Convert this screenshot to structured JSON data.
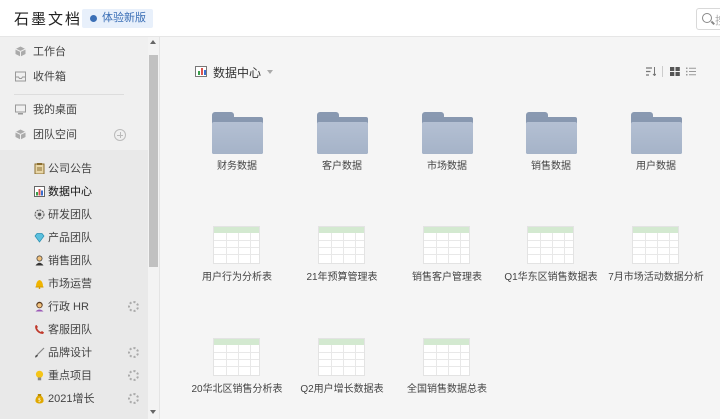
{
  "header": {
    "brand": "石墨文档",
    "beta_label": "体验新版",
    "search_placeholder": "搜"
  },
  "sidebar": {
    "top_items": [
      {
        "label": "工作台",
        "icon": "cube-icon"
      },
      {
        "label": "收件箱",
        "icon": "inbox-icon"
      }
    ],
    "desktop": {
      "label": "我的桌面",
      "icon": "desktop-icon"
    },
    "team_space": {
      "label": "团队空间",
      "icon": "cube-icon"
    },
    "teams": [
      {
        "label": "公司公告",
        "icon": "clipboard-icon"
      },
      {
        "label": "数据中心",
        "icon": "bar-chart-icon",
        "active": true
      },
      {
        "label": "研发团队",
        "icon": "gear-emoji-icon"
      },
      {
        "label": "产品团队",
        "icon": "diamond-icon"
      },
      {
        "label": "销售团队",
        "icon": "person-icon"
      },
      {
        "label": "市场运营",
        "icon": "bell-icon"
      },
      {
        "label": "行政 HR",
        "icon": "woman-icon",
        "settings": true
      },
      {
        "label": "客服团队",
        "icon": "phone-icon"
      },
      {
        "label": "品牌设计",
        "icon": "brush-icon",
        "settings": true
      },
      {
        "label": "重点项目",
        "icon": "lightbulb-icon",
        "settings": true
      },
      {
        "label": "2021增长",
        "icon": "money-bag-icon",
        "settings": true
      }
    ]
  },
  "main": {
    "title": "数据中心",
    "folders": [
      "财务数据",
      "客户数据",
      "市场数据",
      "销售数据",
      "用户数据"
    ],
    "sheets_row1": [
      "用户行为分析表",
      "21年预算管理表",
      "销售客户管理表",
      "Q1华东区销售数据表",
      "7月市场活动数据分析"
    ],
    "sheets_row2": [
      "20华北区销售分析表",
      "Q2用户增长数据表",
      "全国销售数据总表"
    ]
  },
  "colors": {
    "accent": "#3b6fb6",
    "folder": "#a9b6ca",
    "sheet_header": "#d3e9d0"
  }
}
